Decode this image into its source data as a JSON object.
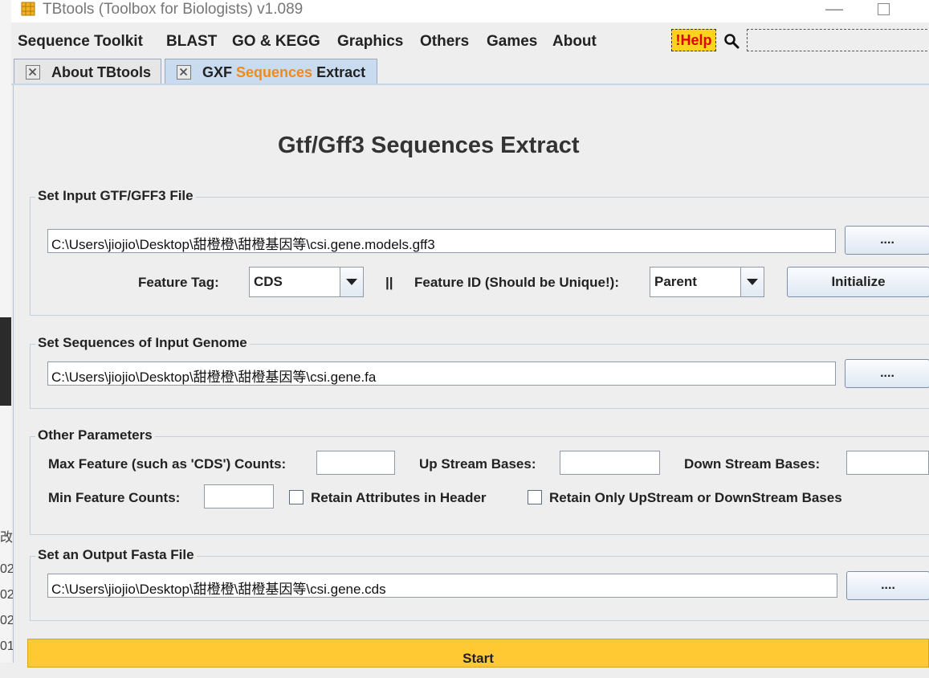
{
  "window": {
    "title": "TBtools (Toolbox for Biologists) v1.089",
    "minimize_glyph": "—"
  },
  "background": {
    "fragments": [
      "改",
      "02",
      "02",
      "02",
      "01"
    ]
  },
  "menu": {
    "items": [
      "Sequence Toolkit",
      "BLAST",
      "GO & KEGG",
      "Graphics",
      "Others",
      "Games",
      "About"
    ],
    "help_label": "!Help",
    "search_value": ""
  },
  "tabs": [
    {
      "label": "About TBtools",
      "selected": false
    },
    {
      "label_prefix": "GXF ",
      "label_highlight": "Sequences",
      "label_suffix": " Extract",
      "selected": true
    }
  ],
  "main": {
    "title": "Gtf/Gff3 Sequences Extract",
    "input_group": {
      "legend": "Set Input GTF/GFF3 File",
      "file_path": "C:\\Users\\jiojio\\Desktop\\甜橙橙\\甜橙基因等\\csi.gene.models.gff3",
      "browse_label": "....",
      "feature_tag_label": "Feature Tag:",
      "feature_tag_value": "CDS",
      "separator": "||",
      "feature_id_label": "Feature ID (Should be Unique!):",
      "feature_id_value": "Parent",
      "initialize_label": "Initialize"
    },
    "genome_group": {
      "legend": "Set Sequences of Input Genome",
      "file_path": "C:\\Users\\jiojio\\Desktop\\甜橙橙\\甜橙基因等\\csi.gene.fa",
      "browse_label": "...."
    },
    "params_group": {
      "legend": "Other Parameters",
      "max_feature_label": "Max Feature (such as 'CDS') Counts:",
      "max_feature_value": "",
      "upstream_label": "Up Stream Bases:",
      "upstream_value": "",
      "downstream_label": "Down Stream Bases:",
      "downstream_value": "",
      "min_feature_label": "Min Feature Counts:",
      "min_feature_value": "",
      "retain_attributes_label": "Retain Attributes in Header",
      "retain_attributes_checked": false,
      "retain_only_label": "Retain Only UpStream or DownStream Bases",
      "retain_only_checked": false
    },
    "output_group": {
      "legend": "Set an Output Fasta File",
      "file_path": "C:\\Users\\jiojio\\Desktop\\甜橙橙\\甜橙基因等\\csi.gene.cds",
      "browse_label": "...."
    },
    "start_label": "Start"
  },
  "colors": {
    "help_bg": "#ffd21e",
    "help_text": "#e00000",
    "tab_highlight": "#f08a1c",
    "start_bg": "#ffc934"
  }
}
